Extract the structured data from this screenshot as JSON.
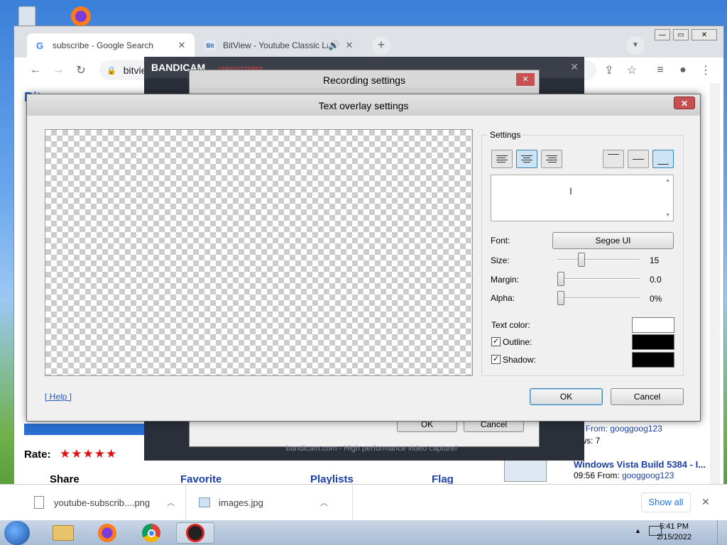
{
  "browser": {
    "tabs": [
      {
        "title": "subscribe - Google Search",
        "favicon": "G"
      },
      {
        "title": "BitView - Youtube Classic La",
        "favicon": "Bit"
      }
    ],
    "omnibox_text": "bitvie"
  },
  "bandicam": {
    "logo": "BANDICAM",
    "unregistered": "UNREGISTERED",
    "recording_settings_title": "Recording settings",
    "ok_label": "OK",
    "cancel_label": "Cancel",
    "footer": "bandicam.com - High performance video capture!"
  },
  "dialog": {
    "title": "Text overlay settings",
    "settings_label": "Settings",
    "font_label": "Font:",
    "font_value": "Segoe UI",
    "size_label": "Size:",
    "size_value": "15",
    "margin_label": "Margin:",
    "margin_value": "0.0",
    "alpha_label": "Alpha:",
    "alpha_value": "0%",
    "text_color_label": "Text color:",
    "outline_label": "Outline:",
    "shadow_label": "Shadow:",
    "help_label": "[ Help ]",
    "ok_label": "OK",
    "cancel_label": "Cancel",
    "text_color": "#ffffff",
    "outline_color": "#000000",
    "shadow_color": "#000000",
    "outline_checked": true,
    "shadow_checked": true,
    "size_fraction": 0.27,
    "margin_fraction": 0.0,
    "alpha_fraction": 0.0
  },
  "webpage": {
    "rate_label": "Rate:",
    "share_label": "Share",
    "favorite_label": "Favorite",
    "playlists_label": "Playlists",
    "flag_label": "Flag",
    "related": [
      {
        "title": "Windows Vista Build 5384 - I...",
        "meta_time": "09:56",
        "from_label": "From:",
        "user": "googgoog123"
      }
    ],
    "side_meta": "53 From: googgoog123",
    "side_views": "iews: 7"
  },
  "downloads": {
    "items": [
      {
        "name": "youtube-subscrib....png"
      },
      {
        "name": "images.jpg"
      }
    ],
    "show_all": "Show all"
  },
  "taskbar": {
    "time": "5:41 PM",
    "date": "2/15/2022"
  }
}
